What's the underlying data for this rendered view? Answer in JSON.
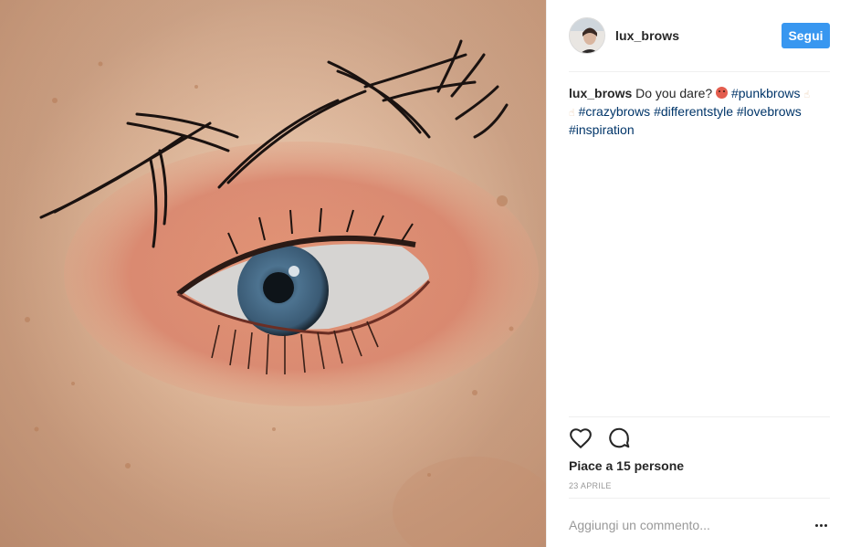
{
  "post": {
    "image_alt": "close-up of an eye with spiky brows and orange eyeshadow"
  },
  "header": {
    "username": "lux_brows",
    "follow_label": "Segui"
  },
  "caption": {
    "username": "lux_brows",
    "text": "Do you dare?",
    "hashtags": [
      "#punkbrows",
      "#crazybrows",
      "#differentstyle",
      "#lovebrows",
      "#inspiration"
    ]
  },
  "actions": {
    "like_icon": "heart-outline-icon",
    "comment_icon": "speech-bubble-icon"
  },
  "likes": {
    "label": "Piace a 15 persone"
  },
  "date": {
    "label": "23 APRILE"
  },
  "comment": {
    "placeholder": "Aggiungi un commento..."
  },
  "colors": {
    "follow_button": "#3897f0",
    "hashtag": "#003569",
    "muted": "#999999"
  }
}
